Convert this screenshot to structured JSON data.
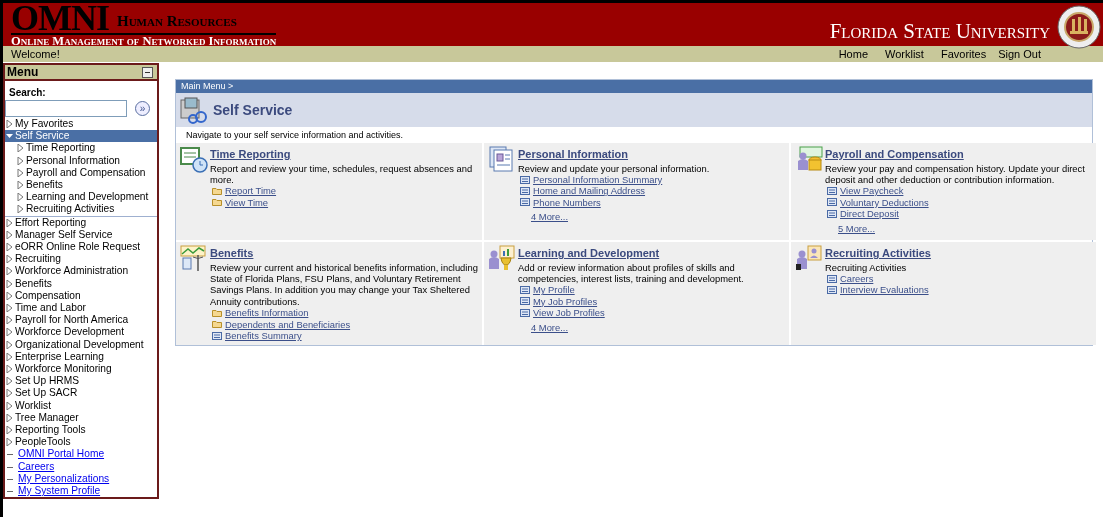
{
  "header": {
    "logo": "OMNI",
    "subtitle_top": "Human Resources",
    "subtitle": "Online Management of Networked Information",
    "university": "Florida State University"
  },
  "welcome": "Welcome!",
  "top_links": [
    "Home",
    "Worklist",
    "Favorites",
    "Sign Out"
  ],
  "menu": {
    "title": "Menu",
    "search_label": "Search:",
    "go_button": "»",
    "items": [
      {
        "label": "My Favorites",
        "kind": "folder",
        "expanded": false,
        "selected": false
      },
      {
        "label": "Self Service",
        "kind": "folder",
        "expanded": true,
        "selected": true,
        "children": [
          {
            "label": "Time Reporting",
            "kind": "folder",
            "expanded": false,
            "selected": false
          },
          {
            "label": "Personal Information",
            "kind": "folder",
            "expanded": false,
            "selected": false
          },
          {
            "label": "Payroll and Compensation",
            "kind": "folder",
            "expanded": false,
            "selected": false
          },
          {
            "label": "Benefits",
            "kind": "folder",
            "expanded": false,
            "selected": false
          },
          {
            "label": "Learning and Development",
            "kind": "folder",
            "expanded": false,
            "selected": false
          },
          {
            "label": "Recruiting Activities",
            "kind": "folder",
            "expanded": false,
            "selected": false
          }
        ]
      },
      {
        "label": "Effort Reporting",
        "kind": "folder",
        "expanded": false,
        "selected": false
      },
      {
        "label": "Manager Self Service",
        "kind": "folder",
        "expanded": false,
        "selected": false
      },
      {
        "label": "eORR Online Role Request",
        "kind": "folder",
        "expanded": false,
        "selected": false
      },
      {
        "label": "Recruiting",
        "kind": "folder",
        "expanded": false,
        "selected": false
      },
      {
        "label": "Workforce Administration",
        "kind": "folder",
        "expanded": false,
        "selected": false
      },
      {
        "label": "Benefits",
        "kind": "folder",
        "expanded": false,
        "selected": false
      },
      {
        "label": "Compensation",
        "kind": "folder",
        "expanded": false,
        "selected": false
      },
      {
        "label": "Time and Labor",
        "kind": "folder",
        "expanded": false,
        "selected": false
      },
      {
        "label": "Payroll for North America",
        "kind": "folder",
        "expanded": false,
        "selected": false
      },
      {
        "label": "Workforce Development",
        "kind": "folder",
        "expanded": false,
        "selected": false
      },
      {
        "label": "Organizational Development",
        "kind": "folder",
        "expanded": false,
        "selected": false
      },
      {
        "label": "Enterprise Learning",
        "kind": "folder",
        "expanded": false,
        "selected": false
      },
      {
        "label": "Workforce Monitoring",
        "kind": "folder",
        "expanded": false,
        "selected": false
      },
      {
        "label": "Set Up HRMS",
        "kind": "folder",
        "expanded": false,
        "selected": false
      },
      {
        "label": "Set Up SACR",
        "kind": "folder",
        "expanded": false,
        "selected": false
      },
      {
        "label": "Worklist",
        "kind": "folder",
        "expanded": false,
        "selected": false
      },
      {
        "label": "Tree Manager",
        "kind": "folder",
        "expanded": false,
        "selected": false
      },
      {
        "label": "Reporting Tools",
        "kind": "folder",
        "expanded": false,
        "selected": false
      },
      {
        "label": "PeopleTools",
        "kind": "folder",
        "expanded": false,
        "selected": false
      },
      {
        "label": "OMNI Portal Home",
        "kind": "link",
        "selected": false
      },
      {
        "label": "Careers",
        "kind": "link",
        "selected": false
      },
      {
        "label": "My Personalizations",
        "kind": "link",
        "selected": false
      },
      {
        "label": "My System Profile",
        "kind": "link",
        "selected": false
      }
    ]
  },
  "breadcrumb": "Main Menu >",
  "page_title": "Self Service",
  "intro": "Navigate to your self service information and activities.",
  "sections": [
    {
      "title": "Time Reporting",
      "description": "Report and review your time, schedules, request absences and more.",
      "links": [
        {
          "label": "Report Time",
          "kind": "folder"
        },
        {
          "label": "View Time",
          "kind": "folder"
        }
      ]
    },
    {
      "title": "Personal Information",
      "description": "Review and update your personal information.",
      "links": [
        {
          "label": "Personal Information Summary",
          "kind": "page"
        },
        {
          "label": "Home and Mailing Address",
          "kind": "page"
        },
        {
          "label": "Phone Numbers",
          "kind": "page"
        }
      ],
      "more": "4 More..."
    },
    {
      "title": "Payroll and Compensation",
      "description": "Review your pay and compensation history. Update your direct deposit and other deduction or contribution information.",
      "links": [
        {
          "label": "View Paycheck",
          "kind": "page"
        },
        {
          "label": "Voluntary Deductions",
          "kind": "page"
        },
        {
          "label": "Direct Deposit",
          "kind": "page"
        }
      ],
      "more": "5 More..."
    },
    {
      "title": "Benefits",
      "description": "Review your current and historical benefits information, including State of Florida Plans, FSU Plans, and Voluntary Retirement Savings Plans. In addition you may change your Tax Sheltered Annuity contributions.",
      "links": [
        {
          "label": "Benefits Information",
          "kind": "folder"
        },
        {
          "label": "Dependents and Beneficiaries",
          "kind": "folder"
        },
        {
          "label": "Benefits Summary",
          "kind": "page"
        }
      ]
    },
    {
      "title": "Learning and Development",
      "description": "Add or review information about profiles of skills and competencies, interest lists, training and development.",
      "links": [
        {
          "label": "My Profile",
          "kind": "page"
        },
        {
          "label": "My Job Profiles",
          "kind": "page"
        },
        {
          "label": "View Job Profiles",
          "kind": "page"
        }
      ],
      "more": "4 More..."
    },
    {
      "title": "Recruiting Activities",
      "description": "Recruiting Activities",
      "links": [
        {
          "label": "Careers",
          "kind": "page"
        },
        {
          "label": "Interview Evaluations",
          "kind": "page"
        }
      ]
    }
  ]
}
